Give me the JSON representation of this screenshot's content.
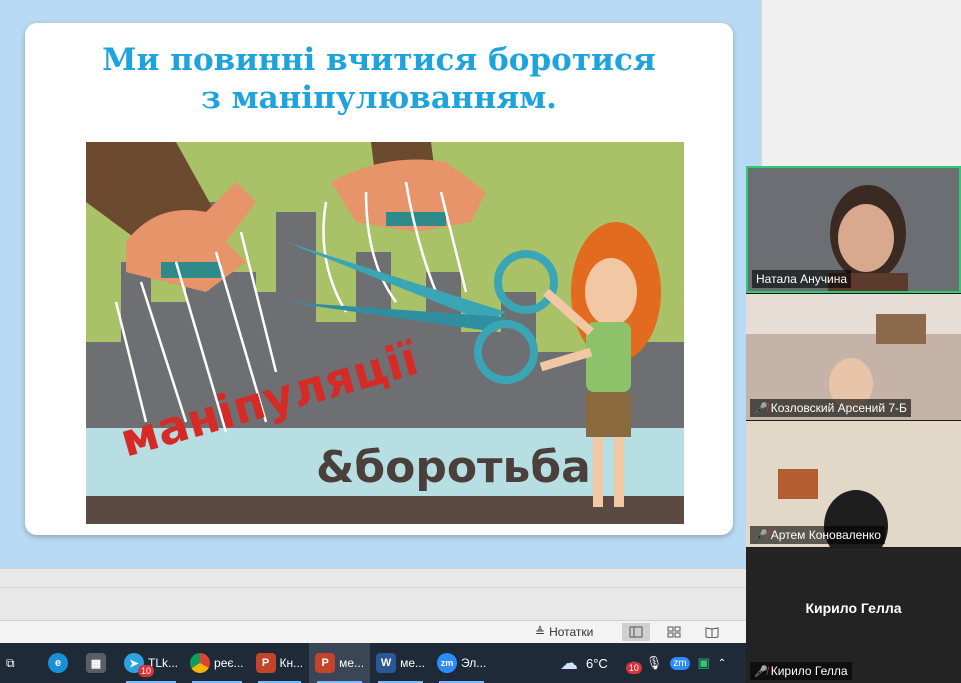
{
  "slide": {
    "title_line1": "Ми повинні вчитися боротися",
    "title_line2": "з маніпулюванням.",
    "image": {
      "word_manipulation": "маніпуляції",
      "word_struggle": "&боротьба"
    }
  },
  "statusbar": {
    "notes_label": "Нотатки"
  },
  "participants": [
    {
      "name": "Натала Анучина",
      "muted": false
    },
    {
      "name": "Козловский Арсений 7-Б",
      "muted": true
    },
    {
      "name": "Артем Коноваленко",
      "muted": true
    },
    {
      "name": "Кирило Гелла",
      "muted": true,
      "video_off": true
    }
  ],
  "taskbar": {
    "items": [
      {
        "label": "TLk...",
        "icon": "telegram-icon",
        "badge": "10"
      },
      {
        "label": "реє...",
        "icon": "chrome-icon"
      },
      {
        "label": "Кн...",
        "icon": "powerpoint-icon"
      },
      {
        "label": "ме...",
        "icon": "powerpoint-icon"
      },
      {
        "label": "ме...",
        "icon": "word-icon"
      },
      {
        "label": "Эл...",
        "icon": "zoom-icon"
      }
    ],
    "weather": "6°C",
    "tray_badge": "10"
  },
  "colors": {
    "title": "#1ea3dc",
    "taskbar": "#1f2a38",
    "active_speaker": "#2ecc71"
  }
}
